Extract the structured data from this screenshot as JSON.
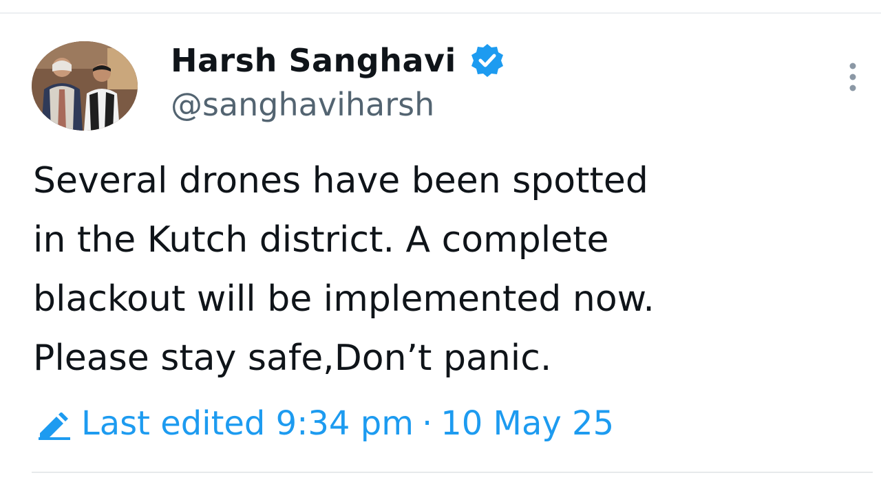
{
  "post": {
    "author": {
      "display_name": "Harsh Sanghavi",
      "handle": "@sanghaviharsh",
      "verified_icon": "verified-badge-icon"
    },
    "text": "Several drones have been spotted\nin the Kutch district. A complete\nblackout will be implemented now.\nPlease stay safe,Don’t panic.",
    "edited": {
      "label": "Last edited",
      "time": "9:34 pm",
      "separator": "·",
      "date": "10 May 25",
      "icon": "pencil-edit-icon"
    },
    "more_icon": "more-options-icon"
  },
  "colors": {
    "text": "#0f1419",
    "handle": "#536471",
    "accent": "#1d9bf0",
    "divider": "#eceff1"
  }
}
